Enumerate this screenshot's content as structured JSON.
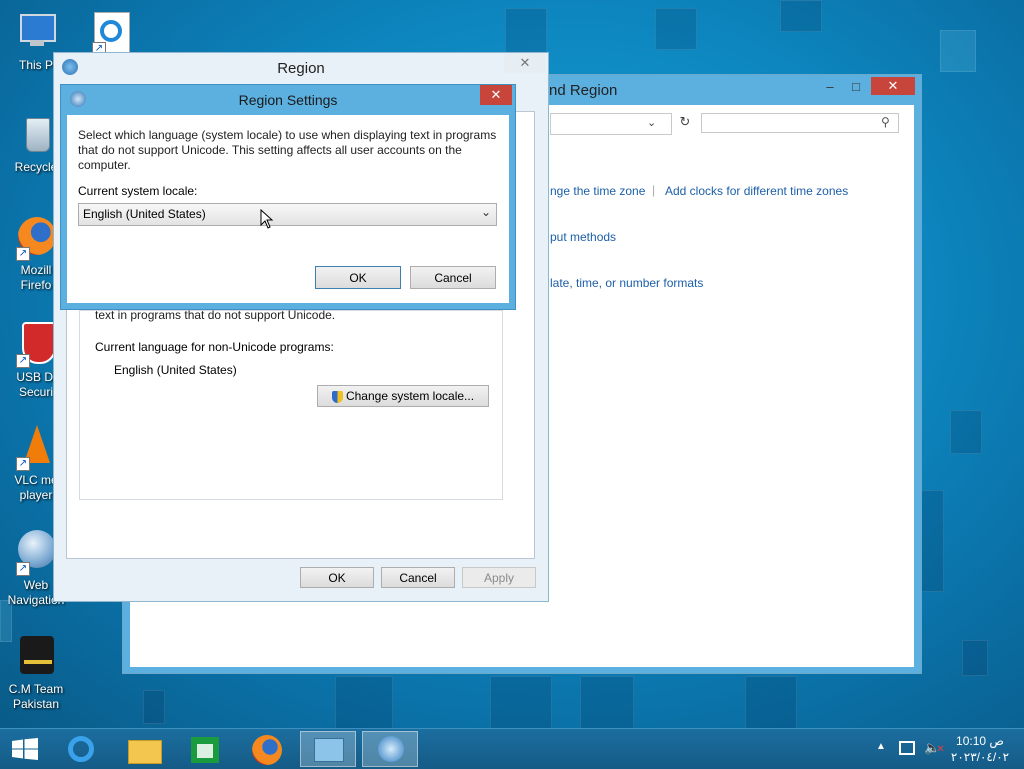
{
  "desktop_icons": [
    {
      "name": "this-pc-icon",
      "label": "This P"
    },
    {
      "name": "recycle-bin-icon",
      "label": "Recycle"
    },
    {
      "name": "firefox-desktop-icon",
      "label": "Mozill Firefo"
    },
    {
      "name": "usb-security-icon",
      "label": "USB Di Securi"
    },
    {
      "name": "vlc-icon",
      "label": "VLC me player"
    },
    {
      "name": "web-navigation-icon",
      "label": "Web Navigation"
    },
    {
      "name": "cm-team-icon",
      "label": "C.M Team Pakistan"
    }
  ],
  "control_panel": {
    "title": "nd Region",
    "minimize": "–",
    "maximize": "□",
    "close": "✕",
    "search_placeholder": "",
    "links": [
      "nge the time zone",
      "Add clocks for different time zones",
      "put methods",
      "late, time, or number formats"
    ],
    "separator": "|"
  },
  "region": {
    "title": "Region",
    "close": "✕",
    "text_partial": "text in programs that do not support Unicode.",
    "current_language_label": "Current language for non-Unicode programs:",
    "current_language_value": "English (United States)",
    "change_locale_button": "Change system locale...",
    "ok": "OK",
    "cancel": "Cancel",
    "apply": "Apply"
  },
  "region_settings": {
    "title": "Region Settings",
    "close": "✕",
    "description": "Select which language (system locale) to use when displaying text in programs that do not support Unicode. This setting affects all user accounts on the computer.",
    "locale_label": "Current system locale:",
    "locale_value": "English (United States)",
    "ok": "OK",
    "cancel": "Cancel"
  },
  "taskbar": {
    "items": [
      {
        "name": "internet-explorer-taskbar-icon"
      },
      {
        "name": "file-explorer-taskbar-icon"
      },
      {
        "name": "store-taskbar-icon"
      },
      {
        "name": "firefox-taskbar-icon"
      },
      {
        "name": "control-panel-taskbar-icon"
      },
      {
        "name": "region-taskbar-icon"
      }
    ],
    "time": "10:10 ص",
    "date": "٢٠٢٣/٠٤/٠٢"
  },
  "colors": {
    "accent_blue": "#5cb0e0",
    "close_red": "#c7453a",
    "link_blue": "#1d5fa8"
  }
}
